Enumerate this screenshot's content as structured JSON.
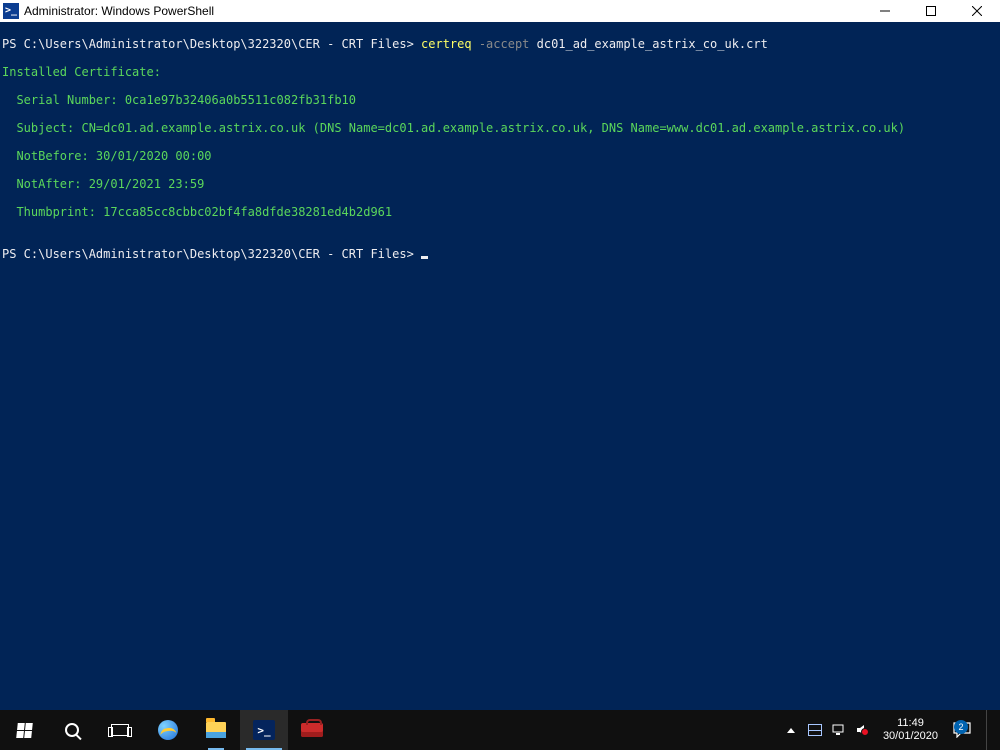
{
  "window": {
    "title": "Administrator: Windows PowerShell"
  },
  "console": {
    "prompt1_prefix": "PS C:\\Users\\Administrator\\Desktop\\322320\\CER - CRT Files> ",
    "cmd_exe": "certreq",
    "cmd_flag": " -accept",
    "cmd_arg": " dc01_ad_example_astrix_co_uk.crt",
    "out_header": "Installed Certificate:",
    "out_serial": "  Serial Number: 0ca1e97b32406a0b5511c082fb31fb10",
    "out_subject": "  Subject: CN=dc01.ad.example.astrix.co.uk (DNS Name=dc01.ad.example.astrix.co.uk, DNS Name=www.dc01.ad.example.astrix.co.uk)",
    "out_nbf": "  NotBefore: 30/01/2020 00:00",
    "out_naf": "  NotAfter: 29/01/2021 23:59",
    "out_thumb": "  Thumbprint: 17cca85cc8cbbc02bf4fa8dfde38281ed4b2d961",
    "blank": "",
    "prompt2": "PS C:\\Users\\Administrator\\Desktop\\322320\\CER - CRT Files> "
  },
  "taskbar": {
    "time": "11:49",
    "date": "30/01/2020",
    "action_center_badge": "2"
  }
}
